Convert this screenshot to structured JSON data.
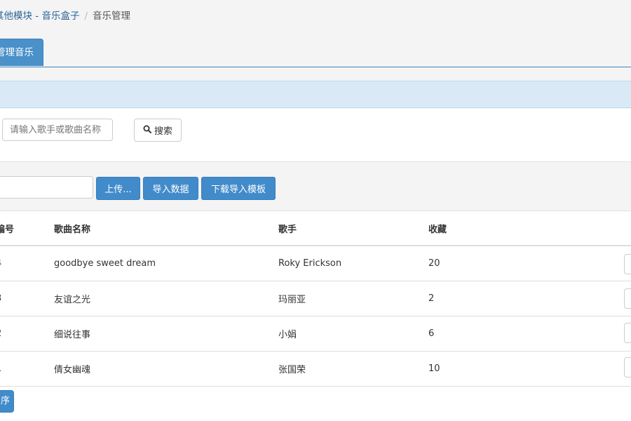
{
  "breadcrumb": {
    "link": "其他模块 - 音乐盒子",
    "separator": "/",
    "current": "音乐管理"
  },
  "tabs": [
    {
      "label": "管理音乐",
      "active": true
    }
  ],
  "search": {
    "placeholder": "请输入歌手或歌曲名称",
    "value": "",
    "button_label": "搜索",
    "icon": "search-icon"
  },
  "toolbar": {
    "upload_label": "上传...",
    "import_label": "导入数据",
    "download_template_label": "下载导入模板"
  },
  "table": {
    "columns": [
      "编号",
      "歌曲名称",
      "歌手",
      "收藏"
    ],
    "rows": [
      {
        "id": "4",
        "title": "goodbye sweet dream",
        "artist": "Roky Erickson",
        "favorites": "20"
      },
      {
        "id": "3",
        "title": "友谊之光",
        "artist": "玛丽亚",
        "favorites": "2"
      },
      {
        "id": "2",
        "title": "细说往事",
        "artist": "小娟",
        "favorites": "6"
      },
      {
        "id": "1",
        "title": "倩女幽魂",
        "artist": "张国荣",
        "favorites": "10"
      }
    ]
  },
  "footer": {
    "button_label": "序"
  },
  "colors": {
    "primary": "#428bca",
    "link": "#2a6496",
    "info_band": "#d9eaf6"
  }
}
